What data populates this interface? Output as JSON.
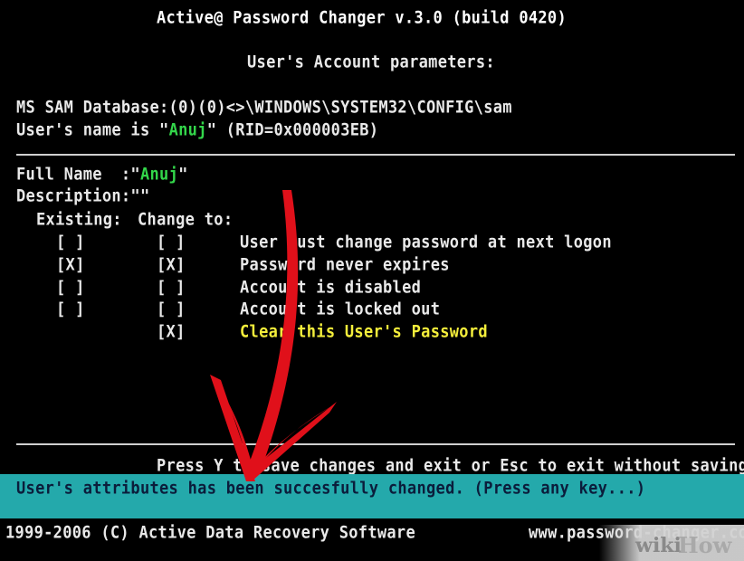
{
  "header": {
    "title": "Active@ Password Changer v.3.0 (build 0420)",
    "subtitle": "User's Account parameters:"
  },
  "account": {
    "sam_path": "MS SAM Database:(0)(0)<>\\WINDOWS\\SYSTEM32\\CONFIG\\sam",
    "user_prefix": "User's name is \"",
    "user_name": "Anuj",
    "user_suffix": "\" (RID=0x000003EB)"
  },
  "details": {
    "full_name_label": "Full Name  :\"",
    "full_name_value": "Anuj",
    "full_name_close": "\"",
    "description": "Description:\"\"",
    "existing_label": "Existing:",
    "change_label": "Change to:"
  },
  "attributes": [
    {
      "existing": "[ ]",
      "change": "[ ]",
      "label": "User must change password at next logon"
    },
    {
      "existing": "[X]",
      "change": "[X]",
      "label": "Password never expires"
    },
    {
      "existing": "[ ]",
      "change": "[ ]",
      "label": "Account is disabled"
    },
    {
      "existing": "[ ]",
      "change": "[ ]",
      "label": "Account is locked out"
    },
    {
      "existing": "",
      "change": "[X]",
      "label": "Clear this User's Password"
    }
  ],
  "prompt": "Press Y to save changes and exit or Esc to exit without saving",
  "status": "User's attributes has been succesfully changed. (Press any key...)",
  "footer": {
    "copyright": "1999-2006 (C) Active Data Recovery Software",
    "url": "www.password-changer.co"
  },
  "watermark": {
    "wiki": "wiki",
    "how": "How"
  },
  "colors": {
    "highlight_green": "#33d64a",
    "highlight_yellow": "#f4ee3b",
    "status_bar": "#24a9ab",
    "arrow": "#e0101a"
  }
}
